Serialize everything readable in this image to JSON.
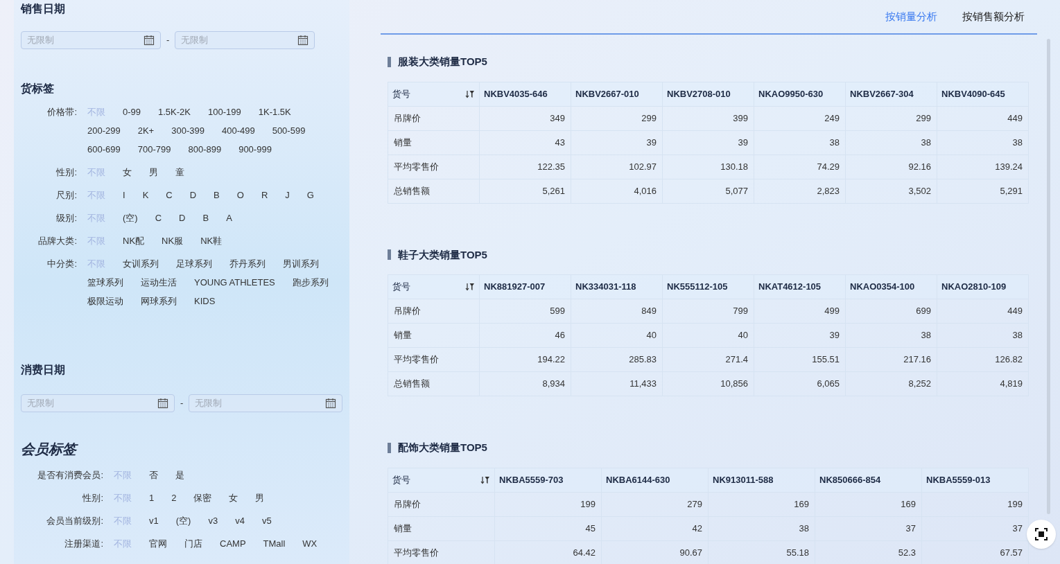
{
  "sales_date": {
    "title": "销售日期",
    "start": {
      "placeholder": "无限制"
    },
    "end": {
      "placeholder": "无限制"
    },
    "separator": "-"
  },
  "goods_tags": {
    "title": "货标签",
    "filters": [
      {
        "label": "价格带:",
        "options": [
          {
            "text": "不限",
            "selected": true
          },
          {
            "text": "0-99",
            "selected": false
          },
          {
            "text": "1.5K-2K",
            "selected": false
          },
          {
            "text": "100-199",
            "selected": false
          },
          {
            "text": "1K-1.5K",
            "selected": false
          },
          {
            "text": "200-299",
            "selected": false
          },
          {
            "text": "2K+",
            "selected": false
          },
          {
            "text": "300-399",
            "selected": false
          },
          {
            "text": "400-499",
            "selected": false
          },
          {
            "text": "500-599",
            "selected": false
          },
          {
            "text": "600-699",
            "selected": false
          },
          {
            "text": "700-799",
            "selected": false
          },
          {
            "text": "800-899",
            "selected": false
          },
          {
            "text": "900-999",
            "selected": false
          }
        ]
      },
      {
        "label": "性别:",
        "options": [
          {
            "text": "不限",
            "selected": true
          },
          {
            "text": "女",
            "selected": false
          },
          {
            "text": "男",
            "selected": false
          },
          {
            "text": "童",
            "selected": false
          }
        ]
      },
      {
        "label": "尺别:",
        "options": [
          {
            "text": "不限",
            "selected": true
          },
          {
            "text": "I",
            "selected": false
          },
          {
            "text": "K",
            "selected": false
          },
          {
            "text": "C",
            "selected": false
          },
          {
            "text": "D",
            "selected": false
          },
          {
            "text": "B",
            "selected": false
          },
          {
            "text": "O",
            "selected": false
          },
          {
            "text": "R",
            "selected": false
          },
          {
            "text": "J",
            "selected": false
          },
          {
            "text": "G",
            "selected": false
          }
        ]
      },
      {
        "label": "级别:",
        "options": [
          {
            "text": "不限",
            "selected": true
          },
          {
            "text": "(空)",
            "selected": false
          },
          {
            "text": "C",
            "selected": false
          },
          {
            "text": "D",
            "selected": false
          },
          {
            "text": "B",
            "selected": false
          },
          {
            "text": "A",
            "selected": false
          }
        ]
      },
      {
        "label": "品牌大类:",
        "options": [
          {
            "text": "不限",
            "selected": true
          },
          {
            "text": "NK配",
            "selected": false
          },
          {
            "text": "NK服",
            "selected": false
          },
          {
            "text": "NK鞋",
            "selected": false
          }
        ]
      },
      {
        "label": "中分类:",
        "options": [
          {
            "text": "不限",
            "selected": true
          },
          {
            "text": "女训系列",
            "selected": false
          },
          {
            "text": "足球系列",
            "selected": false
          },
          {
            "text": "乔丹系列",
            "selected": false
          },
          {
            "text": "男训系列",
            "selected": false
          },
          {
            "text": "篮球系列",
            "selected": false
          },
          {
            "text": "运动生活",
            "selected": false
          },
          {
            "text": "YOUNG ATHLETES",
            "selected": false
          },
          {
            "text": "跑步系列",
            "selected": false
          },
          {
            "text": "极限运动",
            "selected": false
          },
          {
            "text": "网球系列",
            "selected": false
          },
          {
            "text": "KIDS",
            "selected": false
          }
        ]
      }
    ]
  },
  "consume_date": {
    "title": "消费日期",
    "start": {
      "placeholder": "无限制"
    },
    "end": {
      "placeholder": "无限制"
    },
    "separator": "-"
  },
  "member_tags": {
    "title": "会员标签",
    "filters": [
      {
        "label": "是否有消费会员:",
        "options": [
          {
            "text": "不限",
            "selected": true
          },
          {
            "text": "否",
            "selected": false
          },
          {
            "text": "是",
            "selected": false
          }
        ]
      },
      {
        "label": "性别:",
        "options": [
          {
            "text": "不限",
            "selected": true
          },
          {
            "text": "1",
            "selected": false
          },
          {
            "text": "2",
            "selected": false
          },
          {
            "text": "保密",
            "selected": false
          },
          {
            "text": "女",
            "selected": false
          },
          {
            "text": "男",
            "selected": false
          }
        ]
      },
      {
        "label": "会员当前级别:",
        "options": [
          {
            "text": "不限",
            "selected": true
          },
          {
            "text": "v1",
            "selected": false
          },
          {
            "text": "(空)",
            "selected": false
          },
          {
            "text": "v3",
            "selected": false
          },
          {
            "text": "v4",
            "selected": false
          },
          {
            "text": "v5",
            "selected": false
          }
        ]
      },
      {
        "label": "注册渠道:",
        "options": [
          {
            "text": "不限",
            "selected": true
          },
          {
            "text": "官网",
            "selected": false
          },
          {
            "text": "门店",
            "selected": false
          },
          {
            "text": "CAMP",
            "selected": false
          },
          {
            "text": "TMall",
            "selected": false
          },
          {
            "text": "WX",
            "selected": false
          }
        ]
      }
    ]
  },
  "tabs": [
    {
      "label": "按销量分析",
      "selected": true
    },
    {
      "label": "按销售额分析",
      "selected": false
    }
  ],
  "sections": [
    {
      "title": "服装大类销量TOP5",
      "table": {
        "columns": [
          "货号",
          "NKBV4035-646",
          "NKBV2667-010",
          "NKBV2708-010",
          "NKAO9950-630",
          "NKBV2667-304",
          "NKBV4090-645"
        ],
        "rows": [
          [
            "吊牌价",
            "349",
            "299",
            "399",
            "249",
            "299",
            "449"
          ],
          [
            "销量",
            "43",
            "39",
            "39",
            "38",
            "38",
            "38"
          ],
          [
            "平均零售价",
            "122.35",
            "102.97",
            "130.18",
            "74.29",
            "92.16",
            "139.24"
          ],
          [
            "总销售额",
            "5,261",
            "4,016",
            "5,077",
            "2,823",
            "3,502",
            "5,291"
          ]
        ]
      }
    },
    {
      "title": "鞋子大类销量TOP5",
      "table": {
        "columns": [
          "货号",
          "NK881927-007",
          "NK334031-118",
          "NK555112-105",
          "NKAT4612-105",
          "NKAO0354-100",
          "NKAO2810-109"
        ],
        "rows": [
          [
            "吊牌价",
            "599",
            "849",
            "799",
            "499",
            "699",
            "449"
          ],
          [
            "销量",
            "46",
            "40",
            "40",
            "39",
            "38",
            "38"
          ],
          [
            "平均零售价",
            "194.22",
            "285.83",
            "271.4",
            "155.51",
            "217.16",
            "126.82"
          ],
          [
            "总销售额",
            "8,934",
            "11,433",
            "10,856",
            "6,065",
            "8,252",
            "4,819"
          ]
        ]
      }
    },
    {
      "title": "配饰大类销量TOP5",
      "table": {
        "columns": [
          "货号",
          "NKBA5559-703",
          "NKBA6144-630",
          "NK913011-588",
          "NK850666-854",
          "NKBA5559-013"
        ],
        "rows": [
          [
            "吊牌价",
            "199",
            "279",
            "169",
            "169",
            "199"
          ],
          [
            "销量",
            "45",
            "42",
            "38",
            "37",
            "37"
          ],
          [
            "平均零售价",
            "64.42",
            "90.67",
            "55.18",
            "52.3",
            "67.57"
          ]
        ]
      }
    }
  ]
}
